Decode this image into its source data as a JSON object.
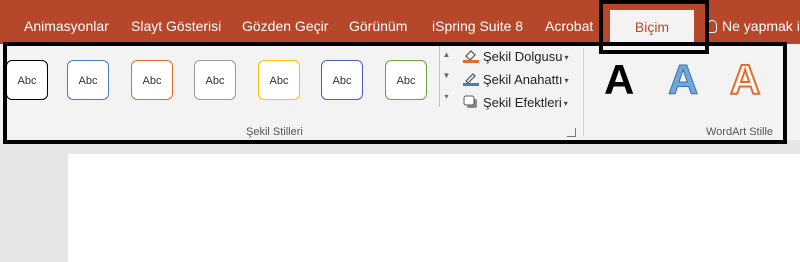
{
  "tabs": [
    {
      "label": "Animasyonlar"
    },
    {
      "label": "Slayt Gösterisi"
    },
    {
      "label": "Gözden Geçir"
    },
    {
      "label": "Görünüm"
    },
    {
      "label": "iSpring Suite 8"
    },
    {
      "label": "Acrobat"
    }
  ],
  "active_tab": {
    "label": "Biçim"
  },
  "tell_me": {
    "label": "Ne yapmak i",
    "icon": "lightbulb-icon"
  },
  "shape_styles": {
    "thumb_text": "Abc",
    "gallery": [
      {
        "border": "#000000"
      },
      {
        "border": "#4a7ebb"
      },
      {
        "border": "#e46c2a"
      },
      {
        "border": "#999999"
      },
      {
        "border": "#ffc000"
      },
      {
        "border": "#4a5fb5"
      },
      {
        "border": "#70a041"
      }
    ],
    "format_items": [
      {
        "label": "Şekil Dolgusu",
        "icon": "paint-bucket-icon"
      },
      {
        "label": "Şekil Anahattı",
        "icon": "pencil-outline-icon"
      },
      {
        "label": "Şekil Efektleri",
        "icon": "shape-effects-icon"
      }
    ],
    "group_label": "Şekil Stilleri"
  },
  "wordart": {
    "sample": "A",
    "group_label": "WordArt Stille",
    "colors": [
      "#000000",
      "#6fa8dc",
      "#e46c2a"
    ]
  },
  "colors": {
    "ribbon_tab_bar": "#b7472a",
    "ribbon_body": "#f3f3f3",
    "highlight": "#000000"
  }
}
